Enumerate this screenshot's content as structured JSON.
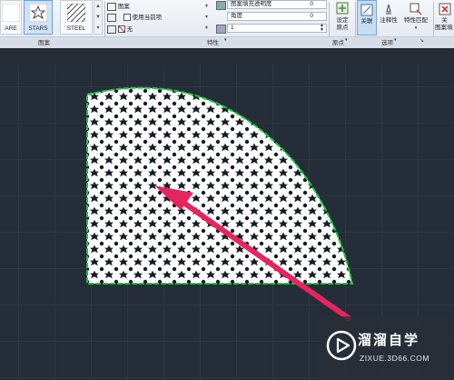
{
  "ribbon": {
    "patterns": [
      {
        "label": "ARE",
        "selected": false
      },
      {
        "label": "STARS",
        "selected": true
      },
      {
        "label": "STEEL",
        "selected": false
      }
    ],
    "pattern_group_label": "图案",
    "hatch_type_value": "图案",
    "hatch_color_value": "使用当前项",
    "background_color_value": "无",
    "transparency_label": "图案填充透明度",
    "transparency_value": "0",
    "angle_label": "角度",
    "angle_value": "0",
    "scale_value": "1",
    "properties_group_label": "特性",
    "set_origin_label_1": "设定",
    "set_origin_label_2": "原点",
    "origin_group_label": "原点",
    "associative_label": "关联",
    "annotative_label": "注释性",
    "match_properties_label": "特性匹配",
    "options_group_label": "选项",
    "close_label_1": "关",
    "close_label_2": "图案填"
  },
  "watermark": {
    "title": "溜溜自学",
    "url": "ZIXUE.3D66.COM"
  },
  "colors": {
    "canvas": "#252d38",
    "boundary": "#19c83a",
    "arrow": "#e8245e"
  }
}
